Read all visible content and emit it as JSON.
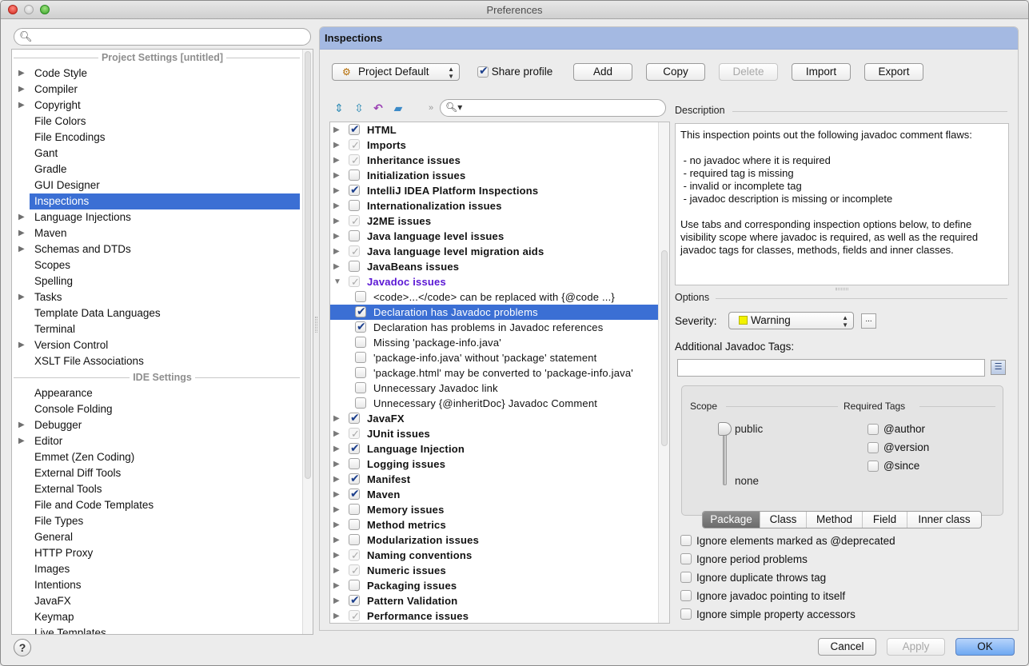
{
  "window": {
    "title": "Preferences"
  },
  "sidebar": {
    "search_placeholder": "",
    "project_section": "Project Settings [untitled]",
    "project_items": [
      {
        "label": "Code Style",
        "expandable": true
      },
      {
        "label": "Compiler",
        "expandable": true
      },
      {
        "label": "Copyright",
        "expandable": true
      },
      {
        "label": "File Colors",
        "expandable": false
      },
      {
        "label": "File Encodings",
        "expandable": false
      },
      {
        "label": "Gant",
        "expandable": false
      },
      {
        "label": "Gradle",
        "expandable": false
      },
      {
        "label": "GUI Designer",
        "expandable": false
      },
      {
        "label": "Inspections",
        "expandable": false,
        "selected": true
      },
      {
        "label": "Language Injections",
        "expandable": true
      },
      {
        "label": "Maven",
        "expandable": true
      },
      {
        "label": "Schemas and DTDs",
        "expandable": true
      },
      {
        "label": "Scopes",
        "expandable": false
      },
      {
        "label": "Spelling",
        "expandable": false
      },
      {
        "label": "Tasks",
        "expandable": true
      },
      {
        "label": "Template Data Languages",
        "expandable": false
      },
      {
        "label": "Terminal",
        "expandable": false
      },
      {
        "label": "Version Control",
        "expandable": true
      },
      {
        "label": "XSLT File Associations",
        "expandable": false
      }
    ],
    "ide_section": "IDE Settings",
    "ide_items": [
      {
        "label": "Appearance",
        "expandable": false
      },
      {
        "label": "Console Folding",
        "expandable": false
      },
      {
        "label": "Debugger",
        "expandable": true
      },
      {
        "label": "Editor",
        "expandable": true
      },
      {
        "label": "Emmet (Zen Coding)",
        "expandable": false
      },
      {
        "label": "External Diff Tools",
        "expandable": false
      },
      {
        "label": "External Tools",
        "expandable": false
      },
      {
        "label": "File and Code Templates",
        "expandable": false
      },
      {
        "label": "File Types",
        "expandable": false
      },
      {
        "label": "General",
        "expandable": false
      },
      {
        "label": "HTTP Proxy",
        "expandable": false
      },
      {
        "label": "Images",
        "expandable": false
      },
      {
        "label": "Intentions",
        "expandable": false
      },
      {
        "label": "JavaFX",
        "expandable": false
      },
      {
        "label": "Keymap",
        "expandable": false
      },
      {
        "label": "Live Templates",
        "expandable": false
      }
    ],
    "help_label": "?"
  },
  "panel": {
    "title": "Inspections",
    "profile": "Project Default",
    "share_profile_label": "Share profile",
    "share_profile_checked": true,
    "buttons": {
      "add": "Add",
      "copy": "Copy",
      "delete": "Delete",
      "import": "Import",
      "export": "Export"
    },
    "toolbar_icons": [
      "expand-all-icon",
      "collapse-all-icon",
      "reset-icon",
      "eraser-icon"
    ],
    "overflow_label": "»",
    "tree_search_value": "",
    "tree": [
      {
        "label": "HTML",
        "state": "checked",
        "level": 0,
        "expandable": true
      },
      {
        "label": "Imports",
        "state": "partial",
        "level": 0,
        "expandable": true
      },
      {
        "label": "Inheritance issues",
        "state": "partial",
        "level": 0,
        "expandable": true
      },
      {
        "label": "Initialization issues",
        "state": "unchecked",
        "level": 0,
        "expandable": true
      },
      {
        "label": "IntelliJ IDEA Platform Inspections",
        "state": "checked",
        "level": 0,
        "expandable": true
      },
      {
        "label": "Internationalization issues",
        "state": "unchecked",
        "level": 0,
        "expandable": true
      },
      {
        "label": "J2ME issues",
        "state": "partial",
        "level": 0,
        "expandable": true
      },
      {
        "label": "Java language level issues",
        "state": "unchecked",
        "level": 0,
        "expandable": true
      },
      {
        "label": "Java language level migration aids",
        "state": "partial",
        "level": 0,
        "expandable": true
      },
      {
        "label": "JavaBeans issues",
        "state": "unchecked",
        "level": 0,
        "expandable": true
      },
      {
        "label": "Javadoc issues",
        "state": "partial",
        "level": 0,
        "expandable": true,
        "expanded": true,
        "highlight": true
      },
      {
        "label": "<code>...</code> can be replaced with {@code ...}",
        "state": "unchecked",
        "level": 1
      },
      {
        "label": "Declaration has Javadoc problems",
        "state": "checked",
        "level": 1,
        "selected": true
      },
      {
        "label": "Declaration has problems in Javadoc references",
        "state": "checked",
        "level": 1
      },
      {
        "label": "Missing 'package-info.java'",
        "state": "unchecked",
        "level": 1
      },
      {
        "label": "'package-info.java' without 'package' statement",
        "state": "unchecked",
        "level": 1
      },
      {
        "label": "'package.html' may be converted to 'package-info.java'",
        "state": "unchecked",
        "level": 1
      },
      {
        "label": "Unnecessary Javadoc link",
        "state": "unchecked",
        "level": 1
      },
      {
        "label": "Unnecessary {@inheritDoc} Javadoc Comment",
        "state": "unchecked",
        "level": 1
      },
      {
        "label": "JavaFX",
        "state": "checked",
        "level": 0,
        "expandable": true
      },
      {
        "label": "JUnit issues",
        "state": "partial",
        "level": 0,
        "expandable": true
      },
      {
        "label": "Language Injection",
        "state": "checked",
        "level": 0,
        "expandable": true
      },
      {
        "label": "Logging issues",
        "state": "unchecked",
        "level": 0,
        "expandable": true
      },
      {
        "label": "Manifest",
        "state": "checked",
        "level": 0,
        "expandable": true
      },
      {
        "label": "Maven",
        "state": "checked",
        "level": 0,
        "expandable": true
      },
      {
        "label": "Memory issues",
        "state": "unchecked",
        "level": 0,
        "expandable": true
      },
      {
        "label": "Method metrics",
        "state": "unchecked",
        "level": 0,
        "expandable": true
      },
      {
        "label": "Modularization issues",
        "state": "unchecked",
        "level": 0,
        "expandable": true
      },
      {
        "label": "Naming conventions",
        "state": "partial",
        "level": 0,
        "expandable": true
      },
      {
        "label": "Numeric issues",
        "state": "partial",
        "level": 0,
        "expandable": true
      },
      {
        "label": "Packaging issues",
        "state": "unchecked",
        "level": 0,
        "expandable": true
      },
      {
        "label": "Pattern Validation",
        "state": "checked",
        "level": 0,
        "expandable": true
      },
      {
        "label": "Performance issues",
        "state": "partial",
        "level": 0,
        "expandable": true
      }
    ],
    "description_label": "Description",
    "description_text": "This inspection points out the following javadoc comment flaws:\n\n - no javadoc where it is required\n - required tag is missing\n - invalid or incomplete tag\n - javadoc description is missing or incomplete\n\nUse tabs and corresponding inspection options below, to define visibility scope where javadoc is required, as well as the required javadoc tags for classes, methods, fields and inner classes.",
    "options_label": "Options",
    "severity_label": "Severity:",
    "severity_value": "Warning",
    "severity_color": "#f2f200",
    "more_label": "...",
    "additional_tags_label": "Additional Javadoc Tags:",
    "additional_tags_value": "",
    "scope_label": "Scope",
    "scope_top": "public",
    "scope_bottom": "none",
    "scope_value": "public",
    "required_tags_label": "Required Tags",
    "required_tags": [
      {
        "label": "@author",
        "checked": false
      },
      {
        "label": "@version",
        "checked": false
      },
      {
        "label": "@since",
        "checked": false
      }
    ],
    "tabs": [
      {
        "label": "Package",
        "active": true
      },
      {
        "label": "Class",
        "active": false
      },
      {
        "label": "Method",
        "active": false
      },
      {
        "label": "Field",
        "active": false
      },
      {
        "label": "Inner class",
        "active": false
      }
    ],
    "ignore_options": [
      {
        "label": "Ignore elements marked as @deprecated",
        "checked": false
      },
      {
        "label": "Ignore period problems",
        "checked": false
      },
      {
        "label": "Ignore duplicate throws tag",
        "checked": false
      },
      {
        "label": "Ignore javadoc pointing to itself",
        "checked": false
      },
      {
        "label": "Ignore simple property accessors",
        "checked": false
      }
    ]
  },
  "footer": {
    "cancel": "Cancel",
    "apply": "Apply",
    "ok": "OK"
  },
  "colors": {
    "selection": "#3b6fd4",
    "header": "#a4b9e2",
    "link": "#5a16d4"
  }
}
